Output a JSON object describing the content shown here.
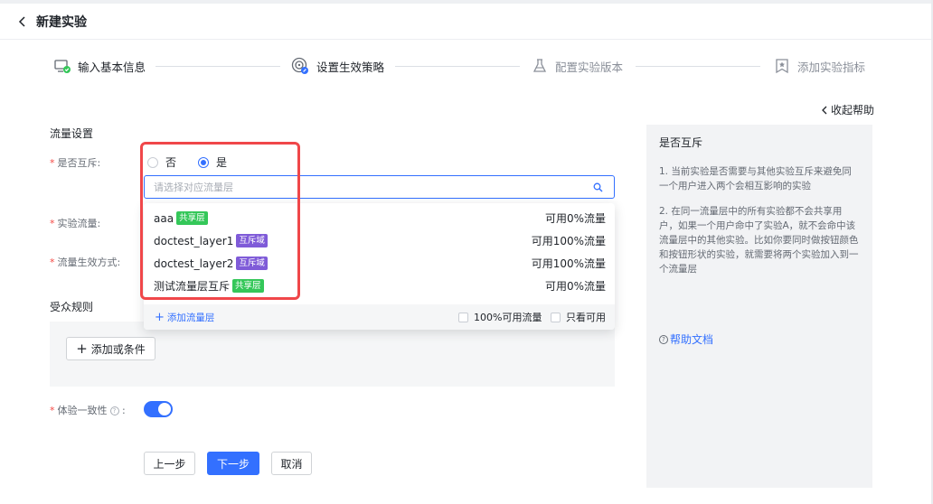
{
  "header": {
    "title": "新建实验"
  },
  "steps": [
    {
      "label": "输入基本信息",
      "icon": "monitor-check-icon",
      "status": "done"
    },
    {
      "label": "设置生效策略",
      "icon": "target-icon",
      "status": "current"
    },
    {
      "label": "配置实验版本",
      "icon": "flask-icon",
      "status": "pending"
    },
    {
      "label": "添加实验指标",
      "icon": "bookmark-star-icon",
      "status": "pending"
    }
  ],
  "help_toggle": {
    "label": "收起帮助"
  },
  "form": {
    "traffic_section_title": "流量设置",
    "mutex": {
      "label": "是否互斥:",
      "options": [
        {
          "label": "否",
          "checked": false
        },
        {
          "label": "是",
          "checked": true
        }
      ]
    },
    "layer_search": {
      "placeholder": "请选择对应流量层",
      "value": ""
    },
    "layer_options": [
      {
        "name": "aaa",
        "tag": "共享层",
        "tag_type": "shared",
        "available": "可用0%流量"
      },
      {
        "name": "doctest_layer1",
        "tag": "互斥域",
        "tag_type": "exclusive",
        "available": "可用100%流量"
      },
      {
        "name": "doctest_layer2",
        "tag": "互斥域",
        "tag_type": "exclusive",
        "available": "可用100%流量"
      },
      {
        "name": "测试流量层互斥",
        "tag": "共享层",
        "tag_type": "shared",
        "available": "可用0%流量"
      }
    ],
    "dropdown_footer": {
      "add_layer_label": "添加流量层",
      "filter_full_label": "100%可用流量",
      "filter_available_label": "只看可用"
    },
    "experiment_traffic_label": "实验流量:",
    "traffic_effect_label": "流量生效方式:",
    "audience_section_title": "受众规则",
    "add_or_condition_label": "添加或条件",
    "consistency": {
      "label": "体验一致性",
      "enabled": true
    }
  },
  "actions": {
    "prev": "上一步",
    "next": "下一步",
    "cancel": "取消"
  },
  "help": {
    "title": "是否互斥",
    "p1": "1. 当前实验是否需要与其他实验互斥来避免同一个用户进入两个会相互影响的实验",
    "p2": "2. 在同一流量层中的所有实验都不会共享用户，如果一个用户命中了实验A，就不会命中该流量层中的其他实验。比如你要同时做按钮颜色和按钮形状的实验，就需要将两个实验加入到一个流量层",
    "doc_link": "帮助文档"
  },
  "colors": {
    "primary": "#3370ff",
    "shared_tag": "#34c759",
    "exclusive_tag": "#7f5bd8",
    "required": "#f54a45",
    "highlight": "#f0474a"
  }
}
